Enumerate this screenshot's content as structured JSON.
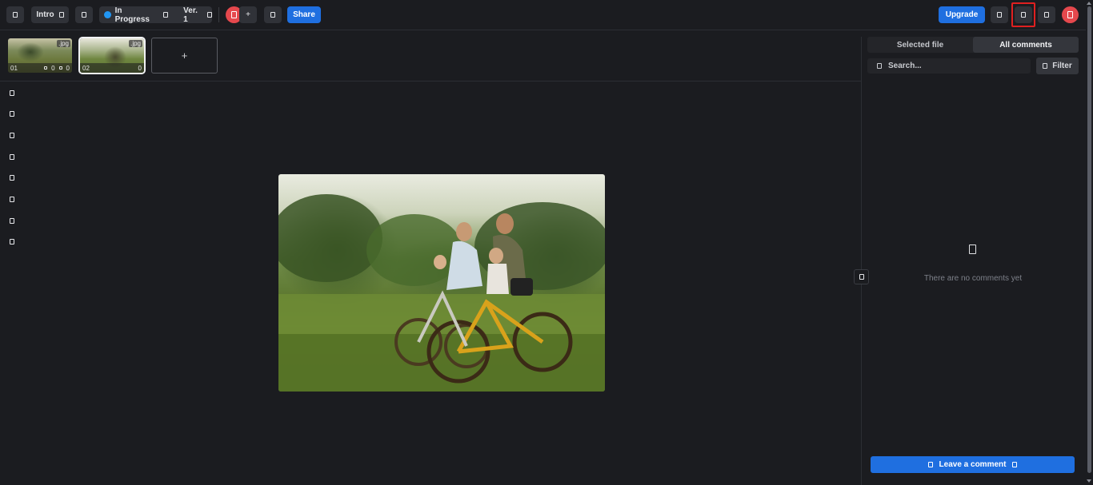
{
  "topbar": {
    "intro_label": "Intro",
    "status_label": "In Progress",
    "version_label": "Ver. 1",
    "add_label": "+",
    "share_label": "Share",
    "upgrade_label": "Upgrade"
  },
  "files": [
    {
      "index": "01",
      "ext": ".jpg",
      "count_a": "0",
      "count_b": "0"
    },
    {
      "index": "02",
      "ext": ".jpg",
      "count_a": "0"
    }
  ],
  "add_file_label": "+",
  "panel": {
    "tabs": [
      "Selected file",
      "All comments"
    ],
    "active_tab": "All comments",
    "search_placeholder": "Search...",
    "filter_label": "Filter",
    "empty_text": "There are no comments yet",
    "leave_comment_label": "Leave a comment"
  },
  "colors": {
    "accent": "#1f6fe0",
    "status_dot": "#2196f3",
    "danger": "#e5484d",
    "highlight": "#e02020"
  },
  "icons": {
    "menu": "menu-icon",
    "tools": [
      "select-icon",
      "pen-icon",
      "shape-icon",
      "arrow-icon",
      "text-icon",
      "color-icon",
      "undo-icon",
      "redo-icon"
    ]
  }
}
